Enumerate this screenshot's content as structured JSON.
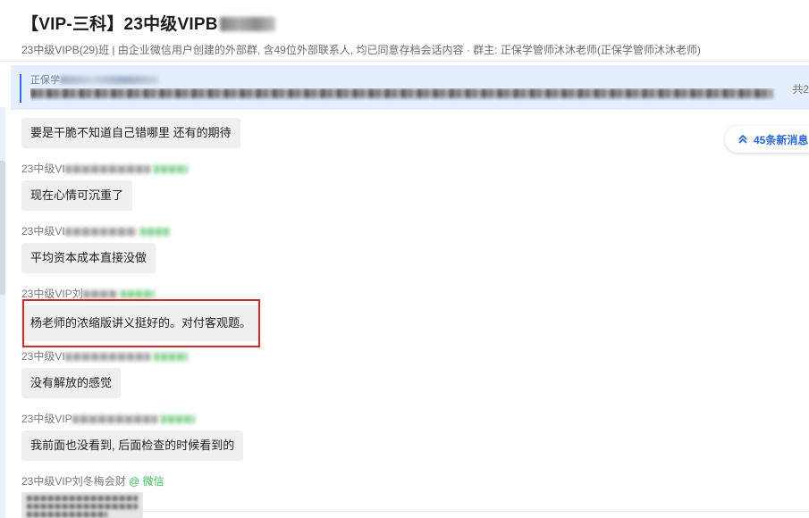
{
  "header": {
    "title": "【VIP-三科】23中级VIPB",
    "subtitle": "23中级VIPB(29)班 | 由企业微信用户创建的外部群, 含49位外部联系人, 均已同意存档会话内容 · 群主: 正保学管师沐沐老师(正保学管师沐沐老师)"
  },
  "notice": {
    "label": "正保学",
    "count": "共2"
  },
  "new_messages": {
    "label": "45条新消息"
  },
  "messages": [
    {
      "sender": "",
      "text": "要是干脆不知道自己错哪里 还有的期待"
    },
    {
      "sender": "23中级VI",
      "text": "现在心情可沉重了"
    },
    {
      "sender": "23中级VI",
      "text": "平均资本成本直接没做"
    },
    {
      "sender": "23中级VIP刘",
      "text": "杨老师的浓缩版讲义挺好的。对付客观题。"
    },
    {
      "sender": "23中级VI",
      "text": "没有解放的感觉"
    },
    {
      "sender": "23中级VIP",
      "text": "我前面也没看到, 后面检查的时候看到的"
    },
    {
      "sender": "23中级VIP刘冬梅会财",
      "tag": "@ 微信",
      "text": ""
    }
  ],
  "colors": {
    "accent_blue": "#2a67d8",
    "notice_bg": "#e4eefc",
    "wechat_green": "#3db85a",
    "highlight_red": "#d8262d",
    "bubble_bg": "#efefef"
  },
  "icons": {
    "new_messages": "double-chevron-up-icon"
  }
}
